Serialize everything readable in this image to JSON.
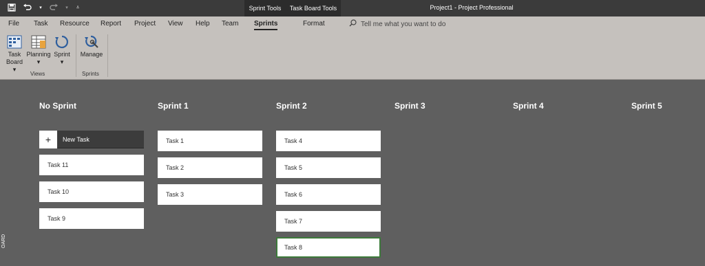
{
  "titlebar": {
    "context_tabs": [
      "Sprint Tools",
      "Task Board Tools"
    ],
    "document_title": "Project1  -  Project Professional"
  },
  "ribbon": {
    "tabs": [
      "File",
      "Task",
      "Resource",
      "Report",
      "Project",
      "View",
      "Help",
      "Team",
      "Sprints",
      "Format"
    ],
    "active_tab": "Sprints",
    "tell_me": "Tell me what you want to do",
    "groups": {
      "views": {
        "label": "Views",
        "buttons": [
          {
            "label": "Task",
            "label2": "Board ▾",
            "icon": "task-board-icon"
          },
          {
            "label": "Planning",
            "label2": "▾",
            "icon": "planning-icon"
          },
          {
            "label": "Sprint",
            "label2": "▾",
            "icon": "sprint-icon"
          }
        ]
      },
      "sprints": {
        "label": "Sprints",
        "buttons": [
          {
            "label": "Manage",
            "icon": "manage-sprints-icon"
          }
        ]
      }
    }
  },
  "board": {
    "side_label": "OARD",
    "new_task_label": "New Task",
    "columns": [
      {
        "title": "No Sprint",
        "cards": [
          "Task 11",
          "Task 10",
          "Task 9"
        ]
      },
      {
        "title": "Sprint 1",
        "cards": [
          "Task 1",
          "Task 2",
          "Task 3"
        ]
      },
      {
        "title": "Sprint 2",
        "cards": [
          "Task 4",
          "Task 5",
          "Task 6",
          "Task 7",
          "Task 8"
        ]
      },
      {
        "title": "Sprint 3",
        "cards": []
      },
      {
        "title": "Sprint 4",
        "cards": []
      },
      {
        "title": "Sprint 5",
        "cards": []
      }
    ],
    "selected_card": "Task 8"
  },
  "colors": {
    "titlebar": "#3b3b3b",
    "ribbon": "#c5c1bd",
    "board": "#5f5f5f",
    "card": "#ffffff",
    "selected_border": "#3c7a3a"
  }
}
